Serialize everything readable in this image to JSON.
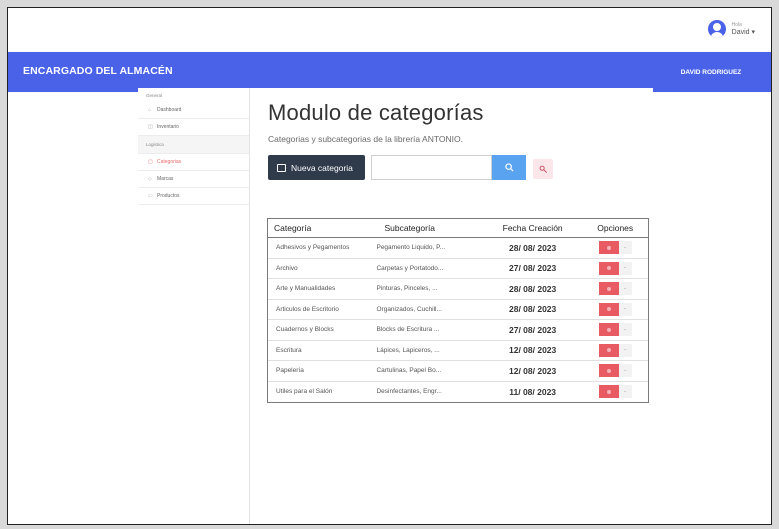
{
  "header": {
    "greeting": "Hola",
    "user_name": "David ▾",
    "brand": "ENCARGADO DEL ALMACÉN",
    "right_name": "DAVID RODRIGUEZ"
  },
  "sidebar": {
    "group_general": "General",
    "items_general": [
      {
        "label": "Dashboard",
        "icon": "home-icon"
      },
      {
        "label": "Inventario",
        "icon": "inventory-icon"
      }
    ],
    "group_logistica": "Logistica",
    "items_logistica": [
      {
        "label": "Categorias",
        "icon": "tag-icon",
        "active": true
      },
      {
        "label": "Marcas",
        "icon": "brand-icon"
      },
      {
        "label": "Productos",
        "icon": "product-icon"
      }
    ]
  },
  "main": {
    "title": "Modulo de categorías",
    "subtitle": "Categorias y subcategorias de la librería ANTONIO.",
    "new_button": "Nueva categoria",
    "search_placeholder": "",
    "accent_dark": "#2f3a4b",
    "accent_blue": "#5aa3f0",
    "delete_color": "#e95b63"
  },
  "table": {
    "headers": [
      "Categoría",
      "Subcategoría",
      "Fecha Creación",
      "Opciones"
    ],
    "rows": [
      {
        "categoria": "Adhesivos y Pegamentos",
        "subcategoria": "Pegamento Liquido, P...",
        "fecha": "28/ 08/ 2023"
      },
      {
        "categoria": "Archivo",
        "subcategoria": "Carpetas y Portatodo...",
        "fecha": "27/ 08/ 2023"
      },
      {
        "categoria": "Arte y Manualidades",
        "subcategoria": "Pinturas, Pinceles, ...",
        "fecha": "28/ 08/ 2023"
      },
      {
        "categoria": "Articulos de Escritorio",
        "subcategoria": "Organizados, Cuchill...",
        "fecha": "28/ 08/ 2023"
      },
      {
        "categoria": "Cuadernos y Blocks",
        "subcategoria": "Blocks de Escritura ...",
        "fecha": "27/ 08/ 2023"
      },
      {
        "categoria": "Escritura",
        "subcategoria": "Lápices, Lapiceros, ...",
        "fecha": "12/ 08/ 2023"
      },
      {
        "categoria": "Papelería",
        "subcategoria": "Cartulinas, Papel Bo...",
        "fecha": "12/ 08/ 2023"
      },
      {
        "categoria": "Útiles para el Salón",
        "subcategoria": "Desinfectantes, Engr...",
        "fecha": "11/ 08/ 2023"
      }
    ]
  }
}
